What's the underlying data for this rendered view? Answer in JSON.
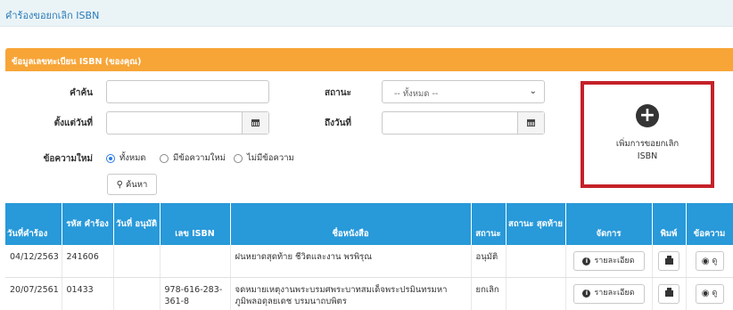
{
  "page": {
    "title": "คำร้องขอยกเลิก ISBN"
  },
  "panel": {
    "title": "ข้อมูลเลขทะเบียน ISBN (ของคุณ)"
  },
  "form": {
    "keyword_label": "คำค้น",
    "keyword_value": "",
    "status_label": "สถานะ",
    "status_selected": "-- ทั้งหมด --",
    "date_from_label": "ตั้งแต่วันที่",
    "date_to_label": "ถึงวันที่",
    "new_message_label": "ข้อความใหม่",
    "radio_options": [
      "ทั้งหมด",
      "มีข้อความใหม่",
      "ไม่มีข้อความ"
    ],
    "radio_selected": "ทั้งหมด",
    "search_button": "ค้นหา"
  },
  "add_request": {
    "line1": "เพิ่มการขอยกเลิก",
    "line2": "ISBN"
  },
  "table": {
    "headers": [
      "วันที่คำร้อง",
      "รหัส คำร้อง",
      "วันที่ อนุมัติ",
      "เลข ISBN",
      "ชื่อหนังสือ",
      "สถานะ",
      "สถานะ สุดท้าย",
      "จัดการ",
      "พิมพ์",
      "ข้อความ"
    ],
    "rows": [
      {
        "date": "04/12/2563",
        "code": "241606",
        "approved": "",
        "isbn": "",
        "book": "ฝนหยาดสุดท้าย ชีวิตและงาน พรพิรุณ",
        "status": "อนุมัติ",
        "last_status": "",
        "detail_label": "รายละเอียด",
        "view_label": "ดู"
      },
      {
        "date": "20/07/2561",
        "code": "01433",
        "approved": "",
        "isbn": "978-616-283-361-8",
        "book": "จดหมายเหตุงานพระบรมศพระบาทสมเด็จพระปรมินทรมหาภูมิพลอดุลยเดช บรมนาถบพิตร",
        "status": "ยกเลิก",
        "last_status": "",
        "detail_label": "รายละเอียด",
        "view_label": "ดู"
      }
    ]
  },
  "icons": {
    "calendar": "calendar-icon",
    "search": "search-icon",
    "plus": "plus-circle-icon",
    "info": "info-icon",
    "print": "printer-icon",
    "view": "eye-icon"
  },
  "colors": {
    "header_blue": "#2899d9",
    "panel_orange": "#f7a537",
    "highlight_red": "#c52129",
    "top_bar": "#eaf4f7"
  }
}
